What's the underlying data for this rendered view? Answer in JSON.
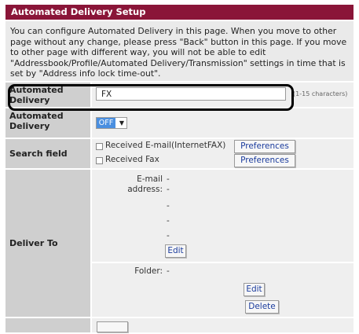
{
  "panel": {
    "title": "Automated Delivery Setup",
    "intro": "You can configure Automated Delivery in this page. When you move to other page without any change, please press \"Back\" button in this page. If you move to other page with different way, you will not be able to edit \"Addressbook/Profile/Automated Delivery/Transmission\" settings in time that is set by \"Address info lock time-out\"."
  },
  "name_row": {
    "label": "Automated Delivery",
    "value": "FX",
    "hint": "(1-15 characters)"
  },
  "state_row": {
    "label": "Automated Delivery",
    "selected": "OFF"
  },
  "search_row": {
    "label": "Search field",
    "email_label": "Received E-mail(InternetFAX)",
    "email_checked": false,
    "fax_label": "Received Fax",
    "fax_checked": false,
    "preferences_label": "Preferences"
  },
  "deliver_row": {
    "label": "Deliver To",
    "email_label": "E-mail address:",
    "email_values": [
      "-",
      "-",
      "-",
      "-",
      "-"
    ],
    "edit_label": "Edit",
    "folder_label": "Folder:",
    "folder_value": "-",
    "delete_label": "Delete"
  }
}
